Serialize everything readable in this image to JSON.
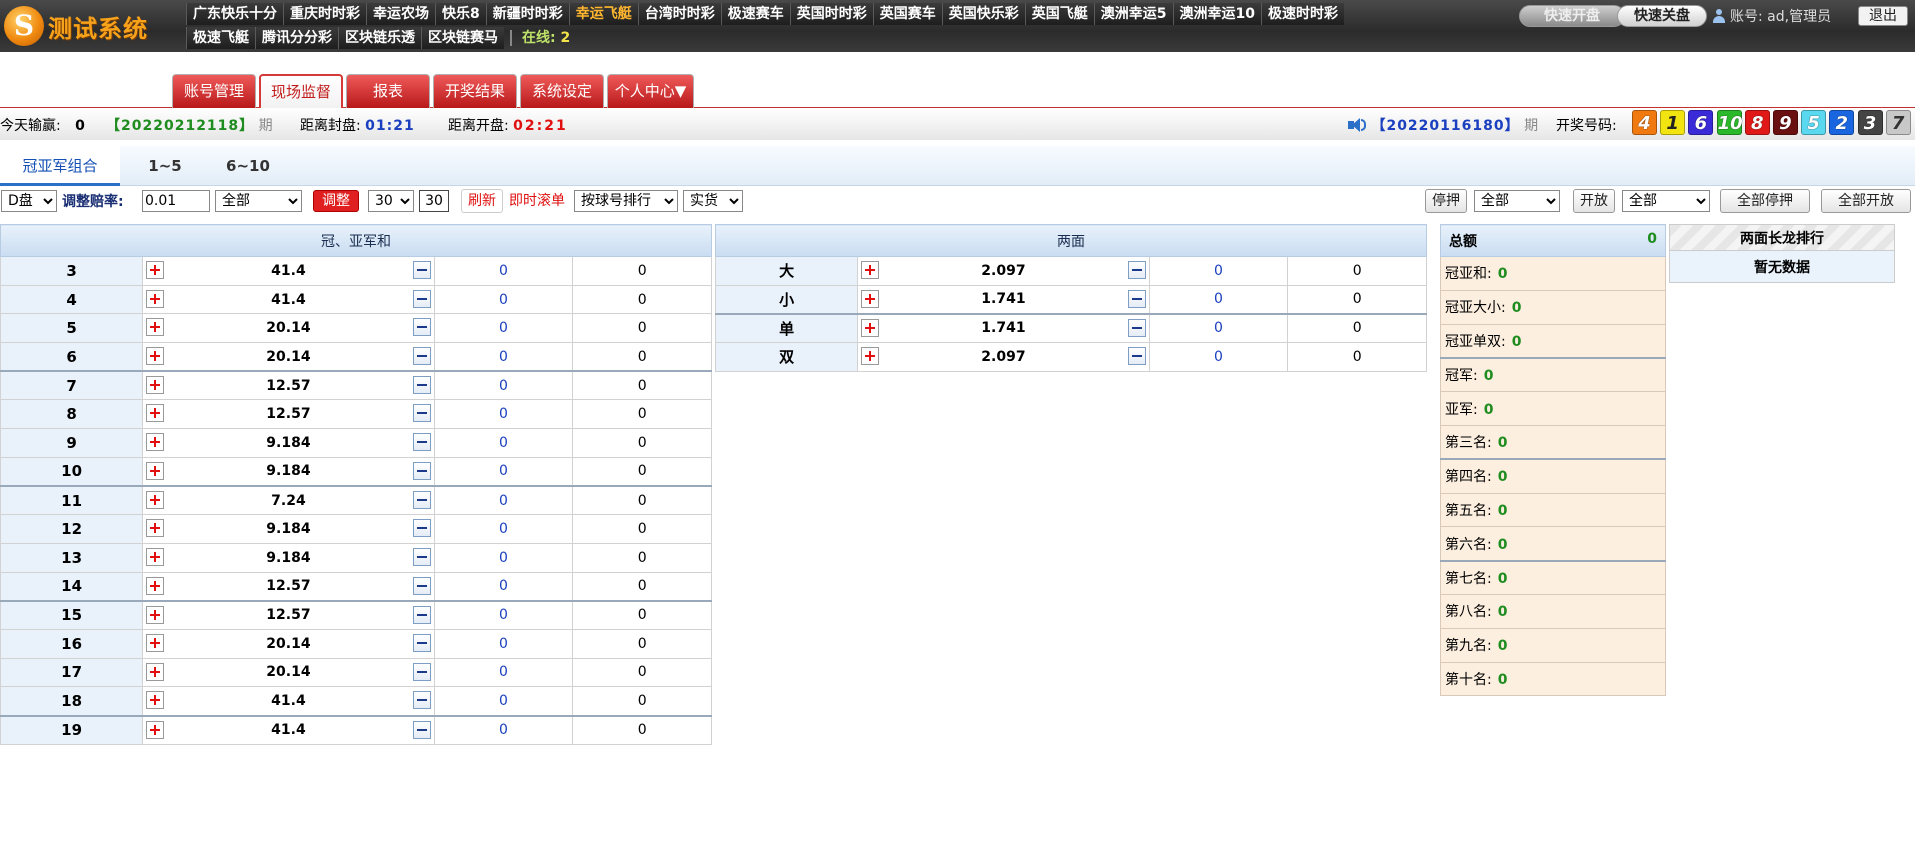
{
  "logo": {
    "mark": "S",
    "name": "测试系统"
  },
  "games_row1": [
    "广东快乐十分",
    "重庆时时彩",
    "幸运农场",
    "快乐8",
    "新疆时时彩",
    "幸运飞艇",
    "台湾时时彩",
    "极速赛车",
    "英国时时彩",
    "英国赛车",
    "英国快乐彩",
    "英国飞艇",
    "澳洲幸运5",
    "澳洲幸运10",
    "极速时时彩"
  ],
  "games_row2": [
    "极速飞艇",
    "腾讯分分彩",
    "区块链乐透",
    "区块链赛马"
  ],
  "active_game": "幸运飞艇",
  "online": {
    "label": "在线:",
    "count": "2"
  },
  "header_buttons": {
    "open": "快速开盘",
    "close": "快速关盘",
    "logout": "退出"
  },
  "account": {
    "text": "账号: ad,管理员"
  },
  "nav_tabs": [
    "账号管理",
    "现场监督",
    "报表",
    "开奖结果",
    "系统设定",
    "个人中心▼"
  ],
  "nav_active": "现场监督",
  "info": {
    "today_label": "今天输赢:",
    "today_value": "0",
    "period": "【20220212118】",
    "period_suffix": "期",
    "close_label": "距离封盘:",
    "close_time": "01:21",
    "open_label": "距离开盘:",
    "open_time": "02:21",
    "last_period": "【20220116180】",
    "last_suffix": "期",
    "result_label": "开奖号码:"
  },
  "result_balls": [
    {
      "n": "4",
      "color": "#f07a10"
    },
    {
      "n": "1",
      "color": "#f2e410"
    },
    {
      "n": "6",
      "color": "#3a2ad8"
    },
    {
      "n": "10",
      "color": "#2bb82b"
    },
    {
      "n": "8",
      "color": "#e01818"
    },
    {
      "n": "9",
      "color": "#6a1010"
    },
    {
      "n": "5",
      "color": "#5ad8f0"
    },
    {
      "n": "2",
      "color": "#1a66e0"
    },
    {
      "n": "3",
      "color": "#444444"
    },
    {
      "n": "7",
      "color": "#c8c8c8"
    }
  ],
  "sub_tabs": [
    "冠亚军组合",
    "1~5",
    "6~10"
  ],
  "controls": {
    "pan": "D盘",
    "adjust_label": "调整赔率:",
    "adjust_value": "0.01",
    "scope": "全部",
    "adjust_btn": "调整",
    "interval": "30",
    "countdown": "30",
    "refresh": "刷新",
    "instant": "即时滚单",
    "sort": "按球号排行",
    "mode": "实货",
    "stop_label": "停押",
    "stop_scope": "全部",
    "open_label": "开放",
    "open_scope": "全部",
    "stop_all": "全部停押",
    "open_all": "全部开放"
  },
  "sum_table": {
    "title": "冠、亚军和",
    "rows": [
      {
        "k": "3",
        "odds": "41.4",
        "s": "0",
        "v": "0"
      },
      {
        "k": "4",
        "odds": "41.4",
        "s": "0",
        "v": "0"
      },
      {
        "k": "5",
        "odds": "20.14",
        "s": "0",
        "v": "0"
      },
      {
        "k": "6",
        "odds": "20.14",
        "s": "0",
        "v": "0"
      },
      {
        "k": "7",
        "odds": "12.57",
        "s": "0",
        "v": "0"
      },
      {
        "k": "8",
        "odds": "12.57",
        "s": "0",
        "v": "0"
      },
      {
        "k": "9",
        "odds": "9.184",
        "s": "0",
        "v": "0"
      },
      {
        "k": "10",
        "odds": "9.184",
        "s": "0",
        "v": "0"
      },
      {
        "k": "11",
        "odds": "7.24",
        "s": "0",
        "v": "0"
      },
      {
        "k": "12",
        "odds": "9.184",
        "s": "0",
        "v": "0"
      },
      {
        "k": "13",
        "odds": "9.184",
        "s": "0",
        "v": "0"
      },
      {
        "k": "14",
        "odds": "12.57",
        "s": "0",
        "v": "0"
      },
      {
        "k": "15",
        "odds": "12.57",
        "s": "0",
        "v": "0"
      },
      {
        "k": "16",
        "odds": "20.14",
        "s": "0",
        "v": "0"
      },
      {
        "k": "17",
        "odds": "20.14",
        "s": "0",
        "v": "0"
      },
      {
        "k": "18",
        "odds": "41.4",
        "s": "0",
        "v": "0"
      },
      {
        "k": "19",
        "odds": "41.4",
        "s": "0",
        "v": "0"
      }
    ]
  },
  "two_sides": {
    "title": "两面",
    "rows": [
      {
        "k": "大",
        "odds": "2.097",
        "s": "0",
        "v": "0"
      },
      {
        "k": "小",
        "odds": "1.741",
        "s": "0",
        "v": "0"
      },
      {
        "k": "单",
        "odds": "1.741",
        "s": "0",
        "v": "0"
      },
      {
        "k": "双",
        "odds": "2.097",
        "s": "0",
        "v": "0"
      }
    ]
  },
  "summary": {
    "title": "总额",
    "total": "0",
    "rows": [
      {
        "label": "冠亚和:",
        "v": "0"
      },
      {
        "label": "冠亚大小:",
        "v": "0"
      },
      {
        "label": "冠亚单双:",
        "v": "0"
      },
      {
        "label": "冠军:",
        "v": "0"
      },
      {
        "label": "亚军:",
        "v": "0"
      },
      {
        "label": "第三名:",
        "v": "0"
      },
      {
        "label": "第四名:",
        "v": "0"
      },
      {
        "label": "第五名:",
        "v": "0"
      },
      {
        "label": "第六名:",
        "v": "0"
      },
      {
        "label": "第七名:",
        "v": "0"
      },
      {
        "label": "第八名:",
        "v": "0"
      },
      {
        "label": "第九名:",
        "v": "0"
      },
      {
        "label": "第十名:",
        "v": "0"
      }
    ]
  },
  "dragon": {
    "title": "两面长龙排行",
    "empty": "暂无数据"
  }
}
